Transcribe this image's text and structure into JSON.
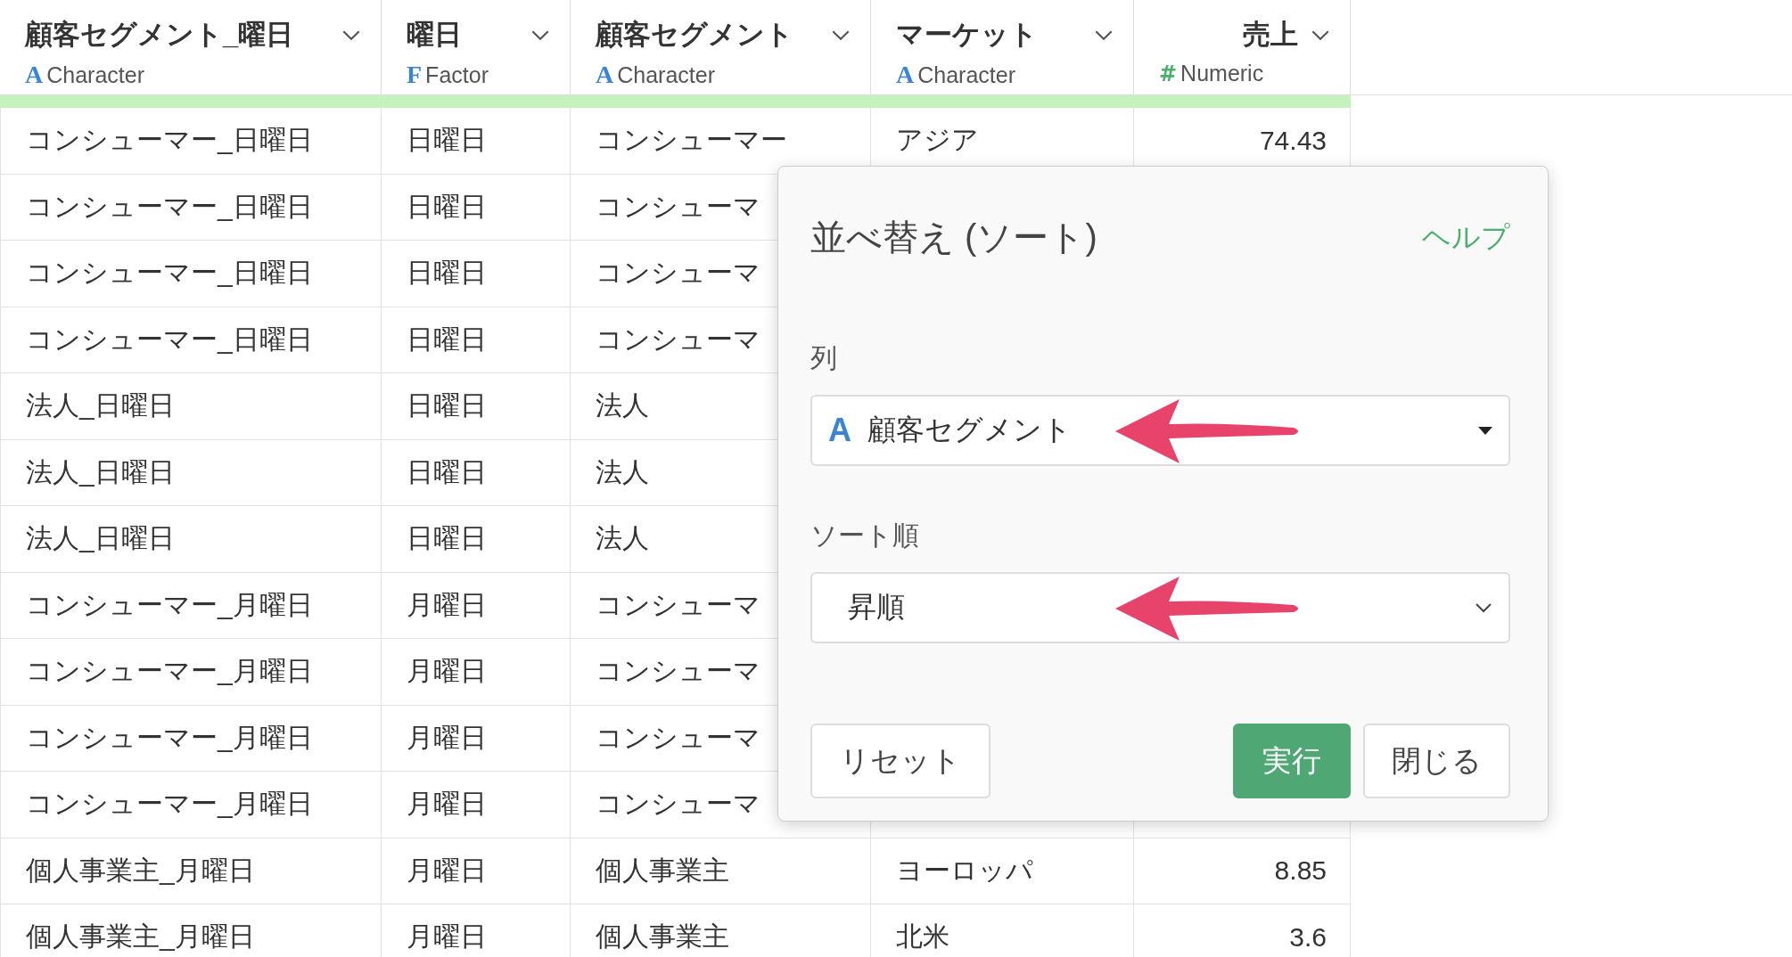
{
  "table": {
    "columns": [
      {
        "name": "顧客セグメント_曜日",
        "kind": "character",
        "type_icon": "A",
        "type": "Character"
      },
      {
        "name": "曜日",
        "kind": "factor",
        "type_icon": "F",
        "type": "Factor"
      },
      {
        "name": "顧客セグメント",
        "kind": "character",
        "type_icon": "A",
        "type": "Character"
      },
      {
        "name": "マーケット",
        "kind": "character",
        "type_icon": "A",
        "type": "Character"
      },
      {
        "name": "売上",
        "kind": "numeric",
        "type_icon": "#",
        "type": "Numeric"
      }
    ],
    "rows": [
      [
        "コンシューマー_日曜日",
        "日曜日",
        "コンシューマー",
        "アジア",
        "74.43"
      ],
      [
        "コンシューマー_日曜日",
        "日曜日",
        "コンシューマ"
      ],
      [
        "コンシューマー_日曜日",
        "日曜日",
        "コンシューマ"
      ],
      [
        "コンシューマー_日曜日",
        "日曜日",
        "コンシューマ"
      ],
      [
        "法人_日曜日",
        "日曜日",
        "法人"
      ],
      [
        "法人_日曜日",
        "日曜日",
        "法人"
      ],
      [
        "法人_日曜日",
        "日曜日",
        "法人"
      ],
      [
        "コンシューマー_月曜日",
        "月曜日",
        "コンシューマ"
      ],
      [
        "コンシューマー_月曜日",
        "月曜日",
        "コンシューマ"
      ],
      [
        "コンシューマー_月曜日",
        "月曜日",
        "コンシューマ"
      ],
      [
        "コンシューマー_月曜日",
        "月曜日",
        "コンシューマ"
      ],
      [
        "個人事業主_月曜日",
        "月曜日",
        "個人事業主",
        "ヨーロッパ",
        "8.85"
      ],
      [
        "個人事業主_月曜日",
        "月曜日",
        "個人事業主",
        "北米",
        "3.6"
      ]
    ]
  },
  "dialog": {
    "title": "並べ替え (ソート)",
    "help_link": "ヘルプ",
    "fields": [
      {
        "label": "列",
        "kind": "column-select",
        "type_icon": "A",
        "value": "顧客セグメント"
      },
      {
        "label": "ソート順",
        "kind": "select",
        "value": "昇順"
      }
    ],
    "buttons": [
      {
        "label": "リセット",
        "kind": "default"
      },
      {
        "label": "実行",
        "kind": "primary"
      },
      {
        "label": "閉じる",
        "kind": "default"
      }
    ]
  }
}
